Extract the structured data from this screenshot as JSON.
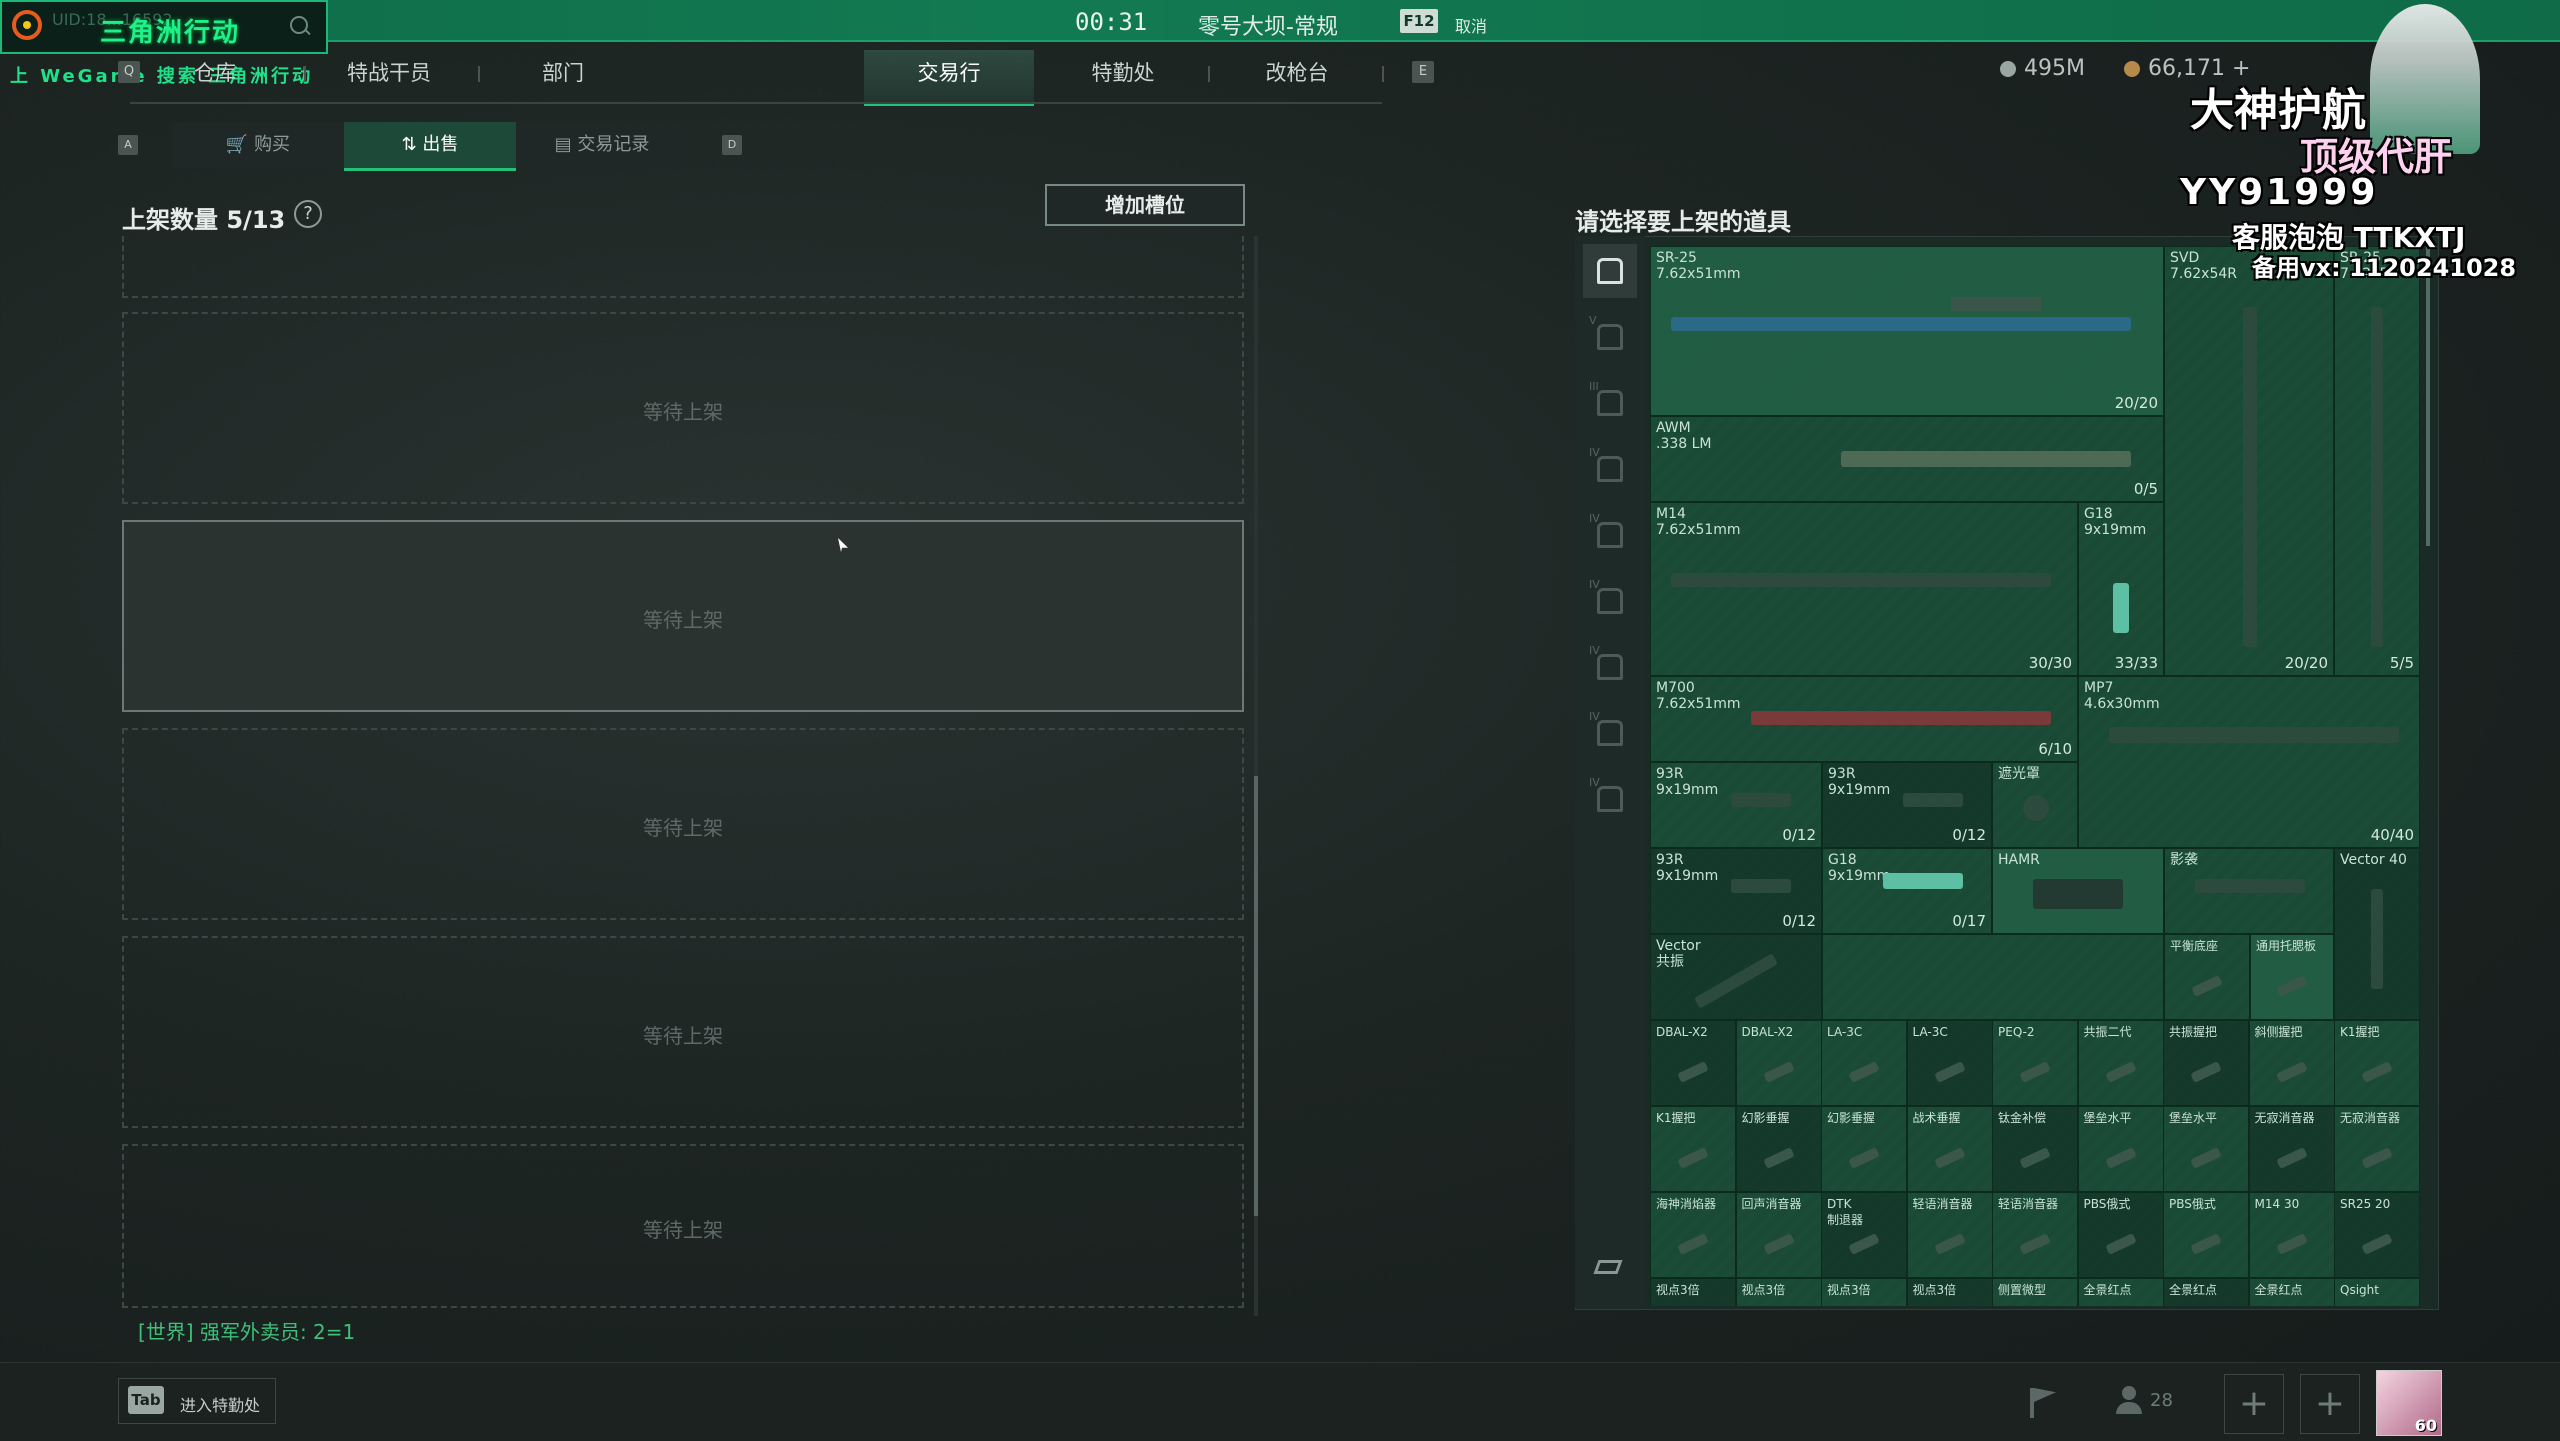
{
  "top": {
    "uid_text": "UID:18...16592",
    "game_title": "三角洲行动",
    "wegame_bar": "上 WeGame 搜索 三角洲行动",
    "timer": "00:31",
    "map_name": "零号大坝-常规",
    "f12_key": "F12",
    "f12_label": "取消"
  },
  "nav": {
    "left_key": "Q",
    "right_key": "E",
    "items": [
      {
        "label": "仓库"
      },
      {
        "label": "特战干员"
      },
      {
        "label": "部门"
      },
      {
        "label": "交易行"
      },
      {
        "label": "特勤处"
      },
      {
        "label": "改枪台"
      }
    ],
    "active": "交易行"
  },
  "currency": {
    "silver": "495M",
    "gold": "66,171 +"
  },
  "sub_tabs": {
    "left_key": "A",
    "right_key": "D",
    "items": [
      {
        "label": "购买"
      },
      {
        "label": "出售"
      },
      {
        "label": "交易记录"
      }
    ],
    "active": "出售"
  },
  "sell": {
    "listing_count": "上架数量 5/13",
    "help": "?",
    "add_slot_button": "增加槽位",
    "slots": [
      {
        "label": "等待上架"
      },
      {
        "label": "等待上架"
      },
      {
        "label": "等待上架"
      },
      {
        "label": "等待上架"
      },
      {
        "label": "等待上架"
      }
    ]
  },
  "chat": "[世界] 强军外卖员: 2=1",
  "bottom": {
    "tab_key": "Tab",
    "tab_label": "进入特勤处",
    "people_count": "28",
    "avatar_level": "60"
  },
  "stash": {
    "title": "请选择要上架的道具",
    "side_tabs": [
      "",
      "V",
      "III",
      "IV",
      "IV",
      "IV",
      "IV",
      "IV",
      "IV"
    ],
    "items": {
      "sr25": {
        "name": "SR-25\n7.62x51mm",
        "count": "20/20"
      },
      "svd": {
        "name": "SVD\n7.62x54R",
        "count": "20/20"
      },
      "sr25b": {
        "name": "SR-25\n7.62x51",
        "count": "5/5"
      },
      "awm": {
        "name": "AWM\n.338 LM",
        "count": "0/5"
      },
      "m14": {
        "name": "M14\n7.62x51mm",
        "count": "30/30"
      },
      "g18a": {
        "name": "G18\n9x19mm",
        "count": "33/33"
      },
      "m700": {
        "name": "M700\n7.62x51mm",
        "count": "6/10"
      },
      "mp7": {
        "name": "MP7\n4.6x30mm",
        "count": "40/40"
      },
      "g93r_1": {
        "name": "93R\n9x19mm",
        "count": "0/12"
      },
      "g93r_2": {
        "name": "93R\n9x19mm",
        "count": "0/12"
      },
      "hood": {
        "name": "遮光罩",
        "count": ""
      },
      "g93r_3": {
        "name": "93R\n9x19mm",
        "count": "0/12"
      },
      "g18b": {
        "name": "G18\n9x19mm",
        "count": "0/17"
      },
      "hamr": {
        "name": "HAMR",
        "count": ""
      },
      "shadow": {
        "name": "影袭",
        "count": ""
      },
      "vector40": {
        "name": "Vector 40",
        "count": ""
      },
      "vector_common": {
        "name": "Vector\n共振",
        "count": ""
      },
      "balance_base": {
        "name": "平衡底座",
        "count": ""
      },
      "universal_grip": {
        "name": "通用托腮板",
        "count": ""
      }
    },
    "row_attach1": [
      "DBAL-X2",
      "DBAL-X2",
      "LA-3C",
      "LA-3C",
      "PEQ-2",
      "共振二代",
      "共振握把",
      "斜侧握把",
      "K1握把"
    ],
    "row_attach2": [
      "K1握把",
      "幻影垂握",
      "幻影垂握",
      "战术垂握",
      "钛金补偿",
      "堡垒水平",
      "堡垒水平",
      "无寂消音器",
      "无寂消音器"
    ],
    "row_attach3": [
      "海神消焰器",
      "回声消音器",
      "DTK\n制退器",
      "轻语消音器",
      "轻语消音器",
      "PBS俄式",
      "PBS俄式",
      "M14 30",
      "SR25 20"
    ],
    "row_attach4": [
      "视点3倍",
      "视点3倍",
      "视点3倍",
      "视点3倍",
      "侧置微型",
      "全景红点",
      "全景红点",
      "全景红点",
      "Qsight"
    ]
  },
  "overlay": {
    "line1": "大神护航",
    "line2": "顶级代肝",
    "line3": "YY91999",
    "line4": "客服泡泡 TTKXTJ",
    "line5": "备用vx: 1120241028"
  }
}
